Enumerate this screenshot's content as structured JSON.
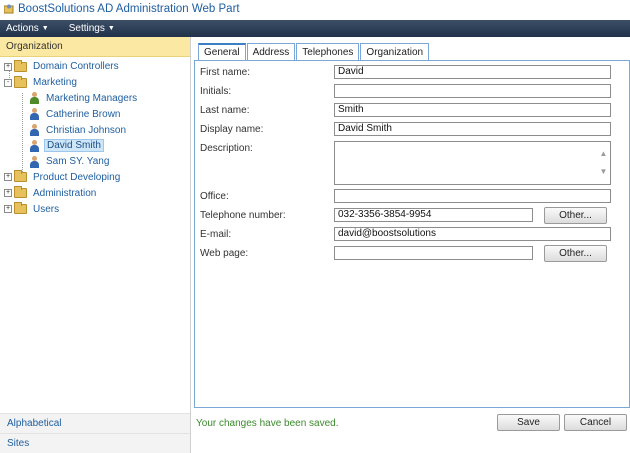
{
  "app": {
    "title": "BoostSolutions AD Administration Web Part"
  },
  "menubar": {
    "actions": "Actions",
    "settings": "Settings"
  },
  "sidebar": {
    "header": "Organization",
    "tree": [
      {
        "label": "Domain Controllers",
        "type": "folder",
        "expander": "+"
      },
      {
        "label": "Marketing",
        "type": "folder",
        "expander": "-"
      },
      {
        "label": "Marketing Managers",
        "type": "group"
      },
      {
        "label": "Catherine Brown",
        "type": "user"
      },
      {
        "label": "Christian Johnson",
        "type": "user"
      },
      {
        "label": "David Smith",
        "type": "user",
        "selected": true
      },
      {
        "label": "Sam SY. Yang",
        "type": "user"
      },
      {
        "label": "Product Developing",
        "type": "folder",
        "expander": "+"
      },
      {
        "label": "Administration",
        "type": "folder",
        "expander": "+"
      },
      {
        "label": "Users",
        "type": "folder",
        "expander": "+"
      }
    ],
    "bottom": {
      "alphabetical": "Alphabetical",
      "sites": "Sites"
    }
  },
  "tabs": [
    "General",
    "Address",
    "Telephones",
    "Organization"
  ],
  "form": {
    "first_name_label": "First name:",
    "first_name": "David",
    "initials_label": "Initials:",
    "initials": "",
    "last_name_label": "Last name:",
    "last_name": "Smith",
    "display_name_label": "Display name:",
    "display_name": "David Smith",
    "description_label": "Description:",
    "office_label": "Office:",
    "office": "",
    "telephone_label": "Telephone number:",
    "telephone": "032-3356-3854-9954",
    "email_label": "E-mail:",
    "email": "david@boostsolutions",
    "webpage_label": "Web page:",
    "webpage": "",
    "other_button": "Other..."
  },
  "status": "Your changes have been saved.",
  "buttons": {
    "save": "Save",
    "cancel": "Cancel"
  },
  "colors": {
    "menubar": "#2c3e55",
    "header_yellow": "#fbe9a3",
    "link_blue": "#1f5fa0",
    "status_green": "#3a8a2c"
  }
}
